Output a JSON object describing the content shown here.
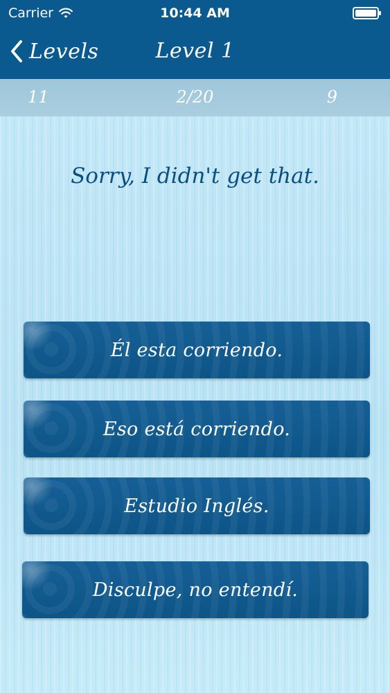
{
  "status_bar": {
    "carrier": "Carrier",
    "time": "10:44 AM"
  },
  "nav": {
    "back_label": "Levels",
    "title": "Level 1"
  },
  "scorebar": {
    "left_value": "11",
    "progress": "2/20",
    "right_value": "9"
  },
  "prompt": "Sorry, I didn't get that.",
  "answers": [
    "Él esta corriendo.",
    "Eso está corriendo.",
    "Estudio Inglés.",
    "Disculpe, no entendí."
  ],
  "colors": {
    "topbar": "#0a5a8f",
    "button": "#0d5587",
    "prompt_text": "#0b4f80",
    "background": "#bfe6f6",
    "scorebar": "#a9cee0"
  },
  "icons": {
    "wifi": "wifi-icon",
    "battery": "battery-icon",
    "back": "chevron-left-icon"
  }
}
